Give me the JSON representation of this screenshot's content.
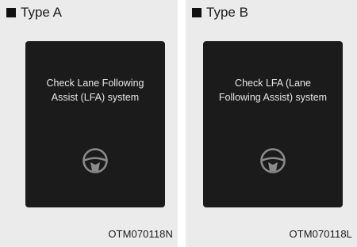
{
  "panels": [
    {
      "heading": "Type A",
      "message_lines": [
        "Check Lane Following",
        "Assist (LFA) system"
      ],
      "icon": "steering-wheel-icon",
      "figure_code": "OTM070118N"
    },
    {
      "heading": "Type B",
      "message_lines": [
        "Check LFA (Lane",
        "Following Assist) system"
      ],
      "icon": "steering-wheel-icon",
      "figure_code": "OTM070118L"
    }
  ],
  "colors": {
    "panel_background": "#ebebeb",
    "screen_background": "#1b1b1b",
    "message_text": "#e6e6e6",
    "icon_stroke": "#8a8a8a"
  }
}
